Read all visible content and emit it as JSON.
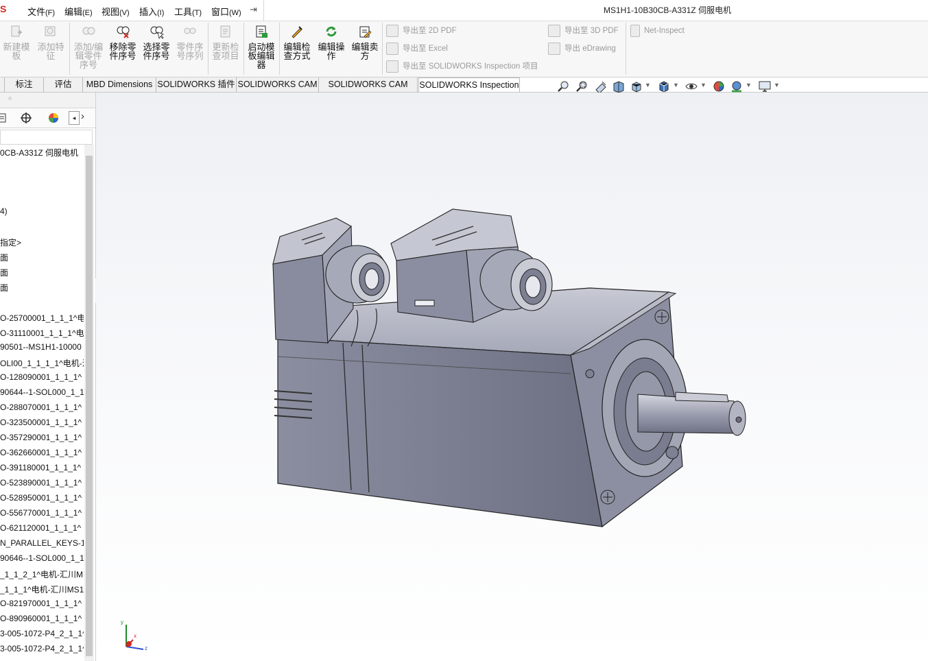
{
  "app": {
    "logo_fragment": "S",
    "document_title": "MS1H1-10B30CB-A331Z 伺服电机"
  },
  "menu": [
    {
      "label": "文件",
      "acc": "(F)"
    },
    {
      "label": "编辑",
      "acc": "(E)"
    },
    {
      "label": "视图",
      "acc": "(V)"
    },
    {
      "label": "插入",
      "acc": "(I)"
    },
    {
      "label": "工具",
      "acc": "(T)"
    },
    {
      "label": "窗口",
      "acc": "(W)"
    }
  ],
  "ribbon": {
    "buttons": [
      {
        "lines": [
          "新建模",
          "板"
        ],
        "icon": "new-template-icon",
        "enabled": false
      },
      {
        "lines": [
          "添加特",
          "征"
        ],
        "icon": "add-feature-icon",
        "enabled": false
      },
      {
        "lines": [
          "添加/编",
          "辑零件",
          "序号"
        ],
        "icon": "add-edit-balloon-icon",
        "enabled": false
      },
      {
        "lines": [
          "移除零",
          "件序号"
        ],
        "icon": "remove-balloon-icon",
        "enabled": true
      },
      {
        "lines": [
          "选择零",
          "件序号"
        ],
        "icon": "select-balloon-icon",
        "enabled": true
      },
      {
        "lines": [
          "零件序",
          "号序列"
        ],
        "icon": "balloon-sequence-icon",
        "enabled": false
      },
      {
        "lines": [
          "更新检",
          "查项目"
        ],
        "icon": "update-inspection-icon",
        "enabled": false
      },
      {
        "lines": [
          "启动模",
          "板编辑",
          "器"
        ],
        "icon": "template-editor-icon",
        "enabled": true
      },
      {
        "lines": [
          "编辑检",
          "查方式"
        ],
        "icon": "edit-inspection-method-icon",
        "enabled": true
      },
      {
        "lines": [
          "编辑操",
          "作"
        ],
        "icon": "edit-operation-icon",
        "enabled": true
      },
      {
        "lines": [
          "编辑卖",
          "方"
        ],
        "icon": "edit-vendor-icon",
        "enabled": true
      }
    ],
    "exports": {
      "pdf2d": "导出至 2D PDF",
      "excel": "导出至 Excel",
      "sw_inspection": "导出至 SOLIDWORKS Inspection 项目",
      "pdf3d": "导出至 3D PDF",
      "edrawing": "导出 eDrawing",
      "net_inspect": "Net-Inspect"
    }
  },
  "tabs": [
    {
      "label": "标注",
      "active": false
    },
    {
      "label": "评估",
      "active": false
    },
    {
      "label": "MBD Dimensions",
      "active": false
    },
    {
      "label": "SOLIDWORKS 插件",
      "active": false
    },
    {
      "label": "SOLIDWORKS CAM",
      "active": false
    },
    {
      "label": "SOLIDWORKS CAM TBM",
      "active": false
    },
    {
      "label": "SOLIDWORKS Inspection",
      "active": true
    }
  ],
  "tree": {
    "root": "0CB-A331Z 伺服电机",
    "rows": [
      {
        "text": "4)"
      },
      {
        "text": "指定>"
      },
      {
        "text": "面"
      },
      {
        "text": "面"
      },
      {
        "text": "面"
      },
      {
        "text": "O-25700001_1_1_1^电"
      },
      {
        "text": "O-31110001_1_1_1^电"
      },
      {
        "text": "90501--MS1H1-10000"
      },
      {
        "text": "OLI00_1_1_1_1^电机-汇"
      },
      {
        "text": "O-128090001_1_1_1^"
      },
      {
        "text": "90644--1-SOL000_1_1"
      },
      {
        "text": "O-288070001_1_1_1^"
      },
      {
        "text": "O-323500001_1_1_1^"
      },
      {
        "text": "O-357290001_1_1_1^"
      },
      {
        "text": "O-362660001_1_1_1^"
      },
      {
        "text": "O-391180001_1_1_1^"
      },
      {
        "text": "O-523890001_1_1_1^"
      },
      {
        "text": "O-528950001_1_1_1^"
      },
      {
        "text": "O-556770001_1_1_1^"
      },
      {
        "text": "O-621120001_1_1_1^"
      },
      {
        "text": "N_PARALLEL_KEYS-1-"
      },
      {
        "text": "90646--1-SOL000_1_1"
      },
      {
        "text": "_1_1_2_1^电机-汇川M"
      },
      {
        "text": "_1_1_1^电机-汇川MS1"
      },
      {
        "text": "O-821970001_1_1_1^"
      },
      {
        "text": "O-890960001_1_1_1^"
      },
      {
        "text": "3-005-1072-P4_2_1_1^"
      },
      {
        "text": "3-005-1072-P4_2_1_1^"
      }
    ]
  },
  "triad": {
    "x": "x",
    "y": "y",
    "z": "z"
  },
  "colors": {
    "accent_red": "#d0281f",
    "motor_body": "#7e8193",
    "motor_light": "#b7b9c6",
    "motor_dark": "#56596b"
  }
}
